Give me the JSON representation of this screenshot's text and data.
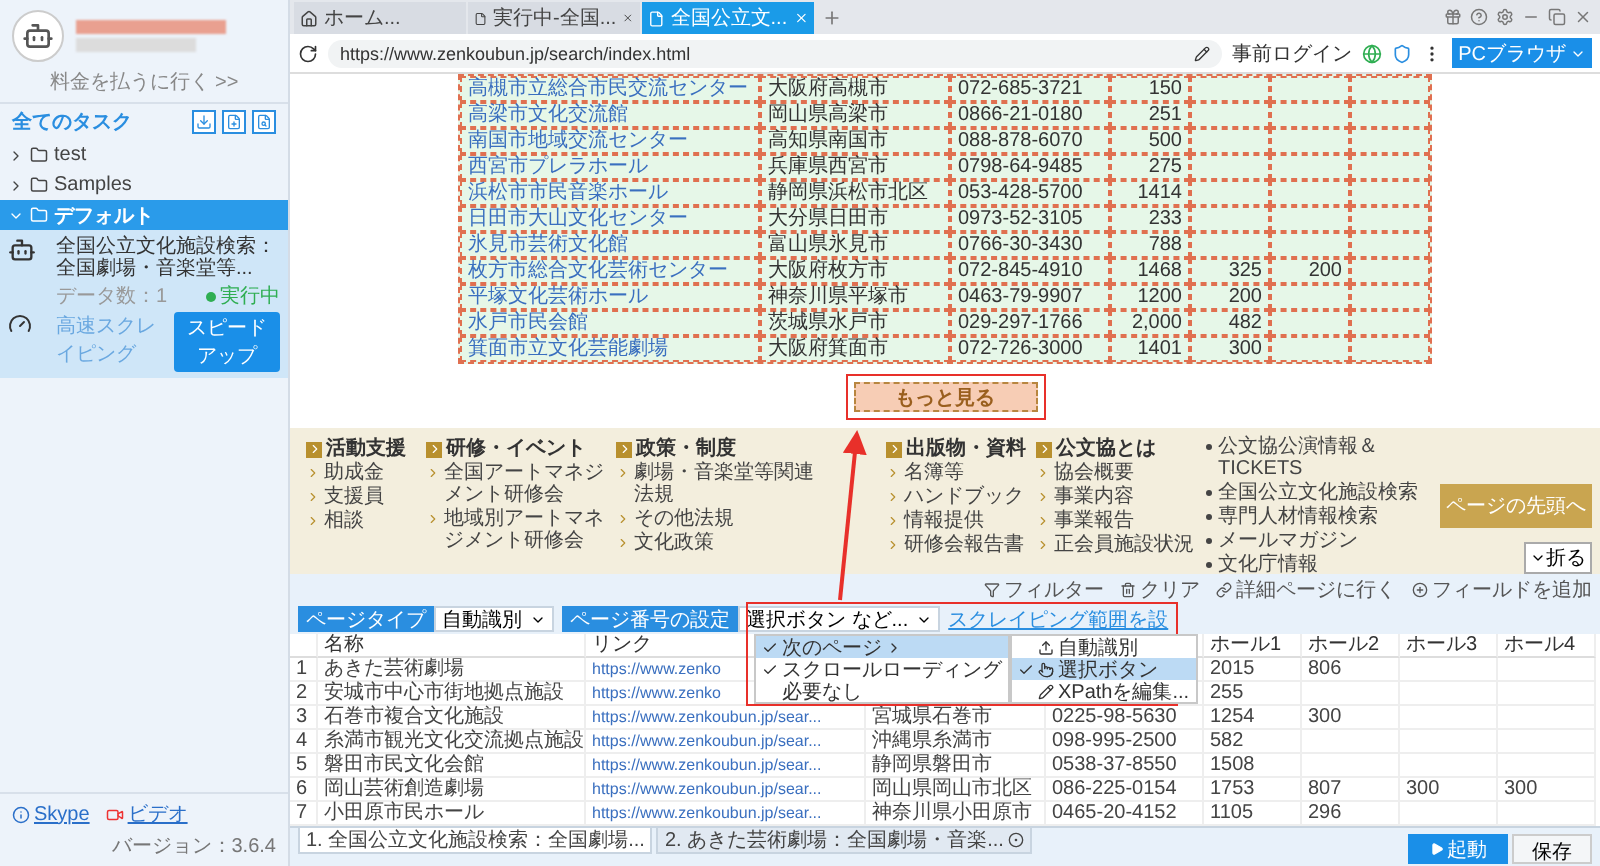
{
  "sidebar": {
    "pay_link": "料金を払うに行く >>",
    "section_title": "全てのタスク",
    "folders": [
      {
        "label": "test",
        "expanded": false,
        "selected": false
      },
      {
        "label": "Samples",
        "expanded": false,
        "selected": false
      },
      {
        "label": "デフォルト",
        "expanded": true,
        "selected": true
      }
    ],
    "task": {
      "title": "全国公立文化施設検索：全国劇場・音楽堂等...",
      "data_count": "データ数：1",
      "status": "実行中",
      "mode": "高速スクレイピング",
      "action": "スピードアップ"
    },
    "links": [
      "Skype",
      "ビデオ"
    ],
    "version": "バージョン：3.6.4"
  },
  "browser": {
    "tabs": [
      {
        "kind": "home",
        "label": "ホーム...",
        "selected": false
      },
      {
        "kind": "page",
        "label": "実行中-全国...",
        "selected": false
      },
      {
        "kind": "page",
        "label": "全国公立文...",
        "selected": true
      }
    ],
    "url": "https://www.zenkoubun.jp/search/index.html",
    "login": "事前ログイン",
    "mode_button": "PCブラウザ"
  },
  "page": {
    "rows": [
      [
        "高槻市立総合市民交流センター",
        "大阪府高槻市",
        "072-685-3721",
        "150",
        "",
        "",
        ""
      ],
      [
        "高梁市文化交流館",
        "岡山県高梁市",
        "0866-21-0180",
        "251",
        "",
        "",
        ""
      ],
      [
        "南国市地域交流センター",
        "高知県南国市",
        "088-878-6070",
        "500",
        "",
        "",
        ""
      ],
      [
        "西宮市プレラホール",
        "兵庫県西宮市",
        "0798-64-9485",
        "275",
        "",
        "",
        ""
      ],
      [
        "浜松市市民音楽ホール",
        "静岡県浜松市北区",
        "053-428-5700",
        "1414",
        "",
        "",
        ""
      ],
      [
        "日田市大山文化センター",
        "大分県日田市",
        "0973-52-3105",
        "233",
        "",
        "",
        ""
      ],
      [
        "氷見市芸術文化館",
        "富山県氷見市",
        "0766-30-3430",
        "788",
        "",
        "",
        ""
      ],
      [
        "枚方市総合文化芸術センター",
        "大阪府枚方市",
        "072-845-4910",
        "1468",
        "325",
        "200",
        ""
      ],
      [
        "平塚文化芸術ホール",
        "神奈川県平塚市",
        "0463-79-9907",
        "1200",
        "200",
        "",
        ""
      ],
      [
        "水戸市民会館",
        "茨城県水戸市",
        "029-297-1766",
        "2,000",
        "482",
        "",
        ""
      ],
      [
        "箕面市立文化芸能劇場",
        "大阪府箕面市",
        "072-726-3000",
        "1401",
        "300",
        "",
        ""
      ]
    ],
    "more_button": "もっと見る",
    "footer_columns": [
      {
        "heading": "活動支援",
        "items": [
          "助成金",
          "支援員",
          "相談"
        ]
      },
      {
        "heading": "研修・イベント",
        "items": [
          "全国アートマネジメント研修会",
          "地域別アートマネジメント研修会"
        ]
      },
      {
        "heading": "政策・制度",
        "items": [
          "劇場・音楽堂等関連法規",
          "その他法規",
          "文化政策"
        ]
      },
      {
        "heading": "出版物・資料",
        "items": [
          "名簿等",
          "ハンドブック",
          "情報提供",
          "研修会報告書"
        ]
      },
      {
        "heading": "公文協とは",
        "items": [
          "協会概要",
          "事業内容",
          "事業報告",
          "正会員施設状況"
        ]
      }
    ],
    "footer_links": [
      "公文協公演情報＆TICKETS",
      "全国公立文化施設検索",
      "専門人材情報検索",
      "メールマガジン",
      "文化庁情報"
    ],
    "top_button": "ページの先頭へ",
    "collapse": "折る"
  },
  "workflow": {
    "page_type_label": "ページタイプ",
    "page_type_value": "自動識別",
    "paging_label": "ページ番号の設定",
    "paging_value": "選択ボタン など...",
    "range_link": "スクレイピング範囲を設",
    "actions": [
      {
        "kind": "filter",
        "label": "フィルター"
      },
      {
        "kind": "clear",
        "label": "クリア"
      },
      {
        "kind": "detail",
        "label": "詳細ページに行く"
      },
      {
        "kind": "add",
        "label": "フィールドを追加"
      }
    ],
    "menu": [
      {
        "label": "次のページ",
        "checked": true,
        "selected": true
      },
      {
        "label": "スクロールローディング",
        "checked": true,
        "selected": false
      },
      {
        "label": "必要なし",
        "checked": false,
        "selected": false
      }
    ],
    "submenu": [
      {
        "kind": "auto",
        "label": "自動識別",
        "checked": false,
        "selected": false
      },
      {
        "kind": "click",
        "label": "選択ボタン",
        "checked": true,
        "selected": true
      },
      {
        "kind": "xpath",
        "label": "XPathを編集...",
        "checked": false,
        "selected": false
      }
    ],
    "columns": [
      "名称",
      "リンク",
      "ホール1",
      "ホール2",
      "ホール3",
      "ホール4"
    ],
    "rows": [
      {
        "number": "1",
        "name": "あきた芸術劇場",
        "link": "https://www.zenko",
        "hall_1": "2015",
        "hall_2": "806"
      },
      {
        "number": "2",
        "name": "安城市中心市街地拠点施設",
        "link": "https://www.zenko",
        "hall_1": "255"
      },
      {
        "number": "3",
        "name": "石巻市複合文化施設",
        "link": "https://www.zenkoubun.jp/sear...",
        "address": "宮城県石巻市",
        "phone": "0225-98-5630",
        "hall_1": "1254",
        "hall_2": "300"
      },
      {
        "number": "4",
        "name": "糸満市観光文化交流拠点施設",
        "link": "https://www.zenkoubun.jp/sear...",
        "address": "沖縄県糸満市",
        "phone": "098-995-2500",
        "hall_1": "582"
      },
      {
        "number": "5",
        "name": "磐田市民文化会館",
        "link": "https://www.zenkoubun.jp/sear...",
        "address": "静岡県磐田市",
        "phone": "0538-37-8550",
        "hall_1": "1508"
      },
      {
        "number": "6",
        "name": "岡山芸術創造劇場",
        "link": "https://www.zenkoubun.jp/sear...",
        "address": "岡山県岡山市北区",
        "phone": "086-225-0154",
        "hall_1": "1753",
        "hall_2": "807",
        "hall_3": "300",
        "hall_4": "300"
      },
      {
        "number": "7",
        "name": "小田原市民ホール",
        "link": "https://www.zenkoubun.jp/sear...",
        "address": "神奈川県小田原市",
        "phone": "0465-20-4152",
        "hall_1": "1105",
        "hall_2": "296"
      }
    ],
    "job_tabs": [
      {
        "label": "1. 全国公立文化施設検索：全国劇場...",
        "selected": true
      },
      {
        "label": "2. あきた芸術劇場：全国劇場・音楽...",
        "selected": false
      }
    ],
    "start_button": "起動",
    "save_button": "保存"
  }
}
